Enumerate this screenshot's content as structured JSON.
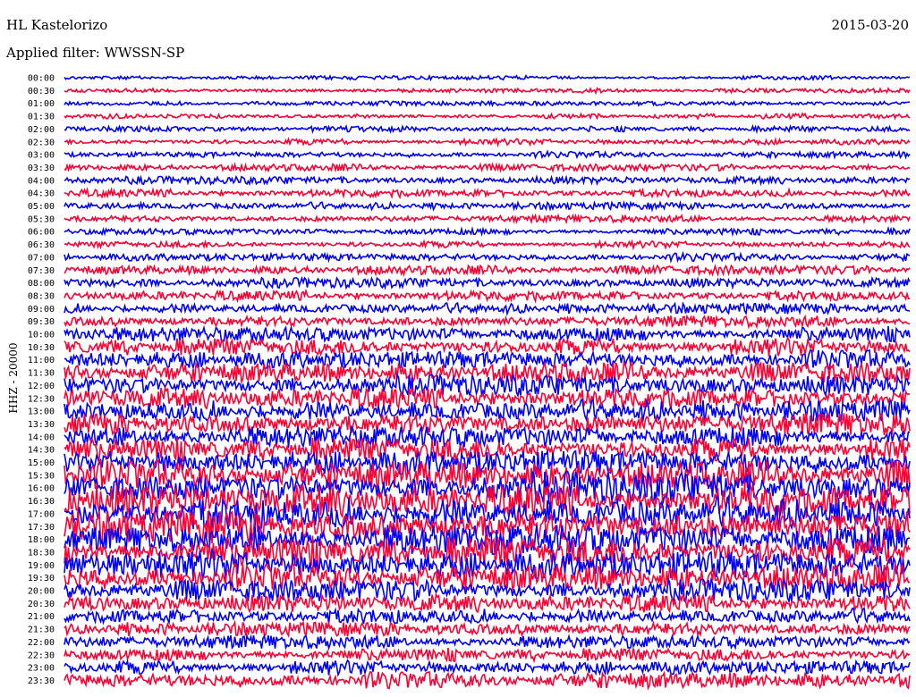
{
  "header": {
    "station": "HL Kastelorizo",
    "date": "2015-03-20",
    "filter_label": "Applied filter: WWSSN-SP"
  },
  "channel_label": "HHZ - 20000",
  "chart_data": {
    "type": "line",
    "title": "HL Kastelorizo",
    "ylabel": "HHZ - 20000",
    "row_colors": [
      "#0000ff",
      "#ff0033"
    ],
    "y_ticks": [
      "00:00",
      "00:30",
      "01:00",
      "01:30",
      "02:00",
      "02:30",
      "03:00",
      "03:30",
      "04:00",
      "04:30",
      "05:00",
      "05:30",
      "06:00",
      "06:30",
      "07:00",
      "07:30",
      "08:00",
      "08:30",
      "09:00",
      "09:30",
      "10:00",
      "10:30",
      "11:00",
      "11:30",
      "12:00",
      "12:30",
      "13:00",
      "13:30",
      "14:00",
      "14:30",
      "15:00",
      "15:30",
      "16:00",
      "16:30",
      "17:00",
      "17:30",
      "18:00",
      "18:30",
      "19:00",
      "19:30",
      "20:00",
      "20:30",
      "21:00",
      "21:30",
      "22:00",
      "22:30",
      "23:00",
      "23:30"
    ],
    "relative_amplitude": [
      0.35,
      0.4,
      0.4,
      0.45,
      0.5,
      0.55,
      0.55,
      0.6,
      0.65,
      0.7,
      0.65,
      0.6,
      0.6,
      0.6,
      0.7,
      0.8,
      0.85,
      0.9,
      0.95,
      1.0,
      1.4,
      1.6,
      1.7,
      1.8,
      1.8,
      1.9,
      2.0,
      2.0,
      2.1,
      2.2,
      2.4,
      2.6,
      2.8,
      2.9,
      3.0,
      3.0,
      3.0,
      2.9,
      2.7,
      2.4,
      1.9,
      1.6,
      1.4,
      1.3,
      1.2,
      1.2,
      1.3,
      1.5
    ]
  }
}
